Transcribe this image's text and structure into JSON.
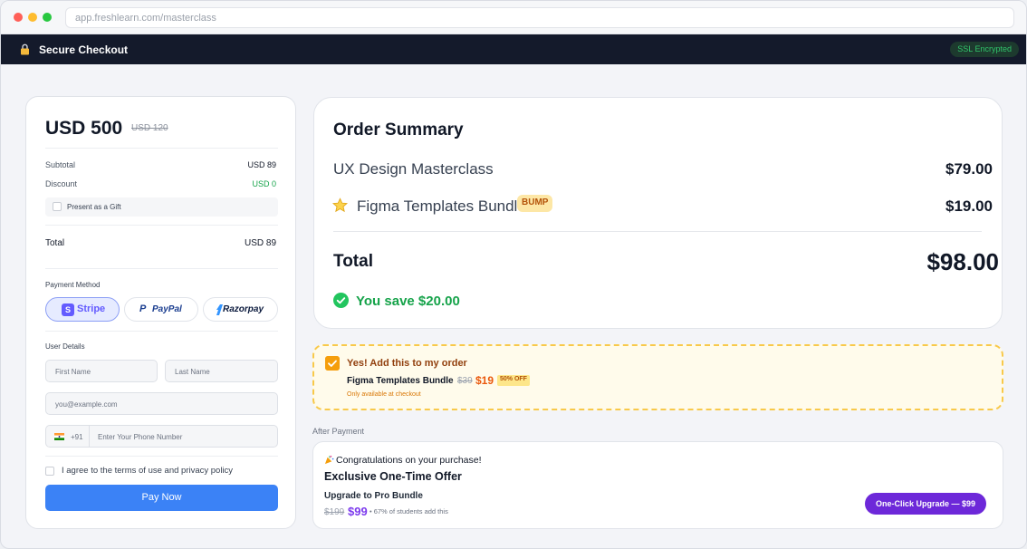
{
  "browser": {
    "url": "app.freshlearn.com/masterclass"
  },
  "appbar": {
    "title": "Secure Checkout",
    "ssl_badge": "SSL Encrypted"
  },
  "checkout": {
    "price": "USD 500",
    "old_price": "USD 120",
    "subtotal_label": "Subtotal",
    "subtotal_value": "USD 89",
    "discount_label": "Discount",
    "discount_value": "USD 0",
    "gift_label": "Present as a Gift",
    "total_label": "Total",
    "total_value": "USD 89",
    "payment_method_label": "Payment Method",
    "payment_methods": [
      {
        "name": "Stripe",
        "icon_letter": "S",
        "selected": true
      },
      {
        "name": "PayPal",
        "icon_letter": "P",
        "selected": false
      },
      {
        "name": "Razorpay",
        "selected": false
      }
    ],
    "user_details_label": "User Details",
    "first_name_placeholder": "First Name",
    "last_name_placeholder": "Last Name",
    "email_placeholder": "you@example.com",
    "country_code": "+91",
    "phone_placeholder": "Enter Your Phone Number",
    "terms_label": "I agree to the terms of use and privacy policy",
    "pay_button": "Pay Now"
  },
  "summary": {
    "title": "Order Summary",
    "items": [
      {
        "name": "UX Design Masterclass",
        "price": "$79.00"
      },
      {
        "name": "Figma Templates Bundle",
        "price": "$19.00",
        "badge": "BUMP"
      }
    ],
    "total_label": "Total",
    "total_value": "$98.00",
    "savings": "You save $20.00"
  },
  "bump": {
    "headline": "Yes! Add this to my order",
    "product": "Figma Templates Bundle",
    "old_price": "$39",
    "new_price": "$19",
    "discount_badge": "50% OFF",
    "note": "Only available at checkout",
    "checked": true
  },
  "after_payment": {
    "label": "After Payment",
    "congrats": "Congratulations on your purchase!",
    "offer_title": "Exclusive One-Time Offer",
    "upgrade_title": "Upgrade to Pro Bundle",
    "old_price": "$199",
    "new_price": "$99",
    "note": "• 67% of students add this",
    "button": "One-Click Upgrade — $99"
  },
  "colors": {
    "header_bg": "#141a2b",
    "primary_blue": "#3b82f6",
    "success_green": "#16a34a",
    "bump_orange": "#f59e0b",
    "upsell_purple": "#6d28d9"
  },
  "icons": [
    "lock-icon",
    "stripe-logo-icon",
    "paypal-logo-icon",
    "razorpay-logo-icon",
    "india-flag-icon",
    "star-icon",
    "check-circle-icon",
    "checkbox-checked-icon",
    "party-popper-icon"
  ]
}
